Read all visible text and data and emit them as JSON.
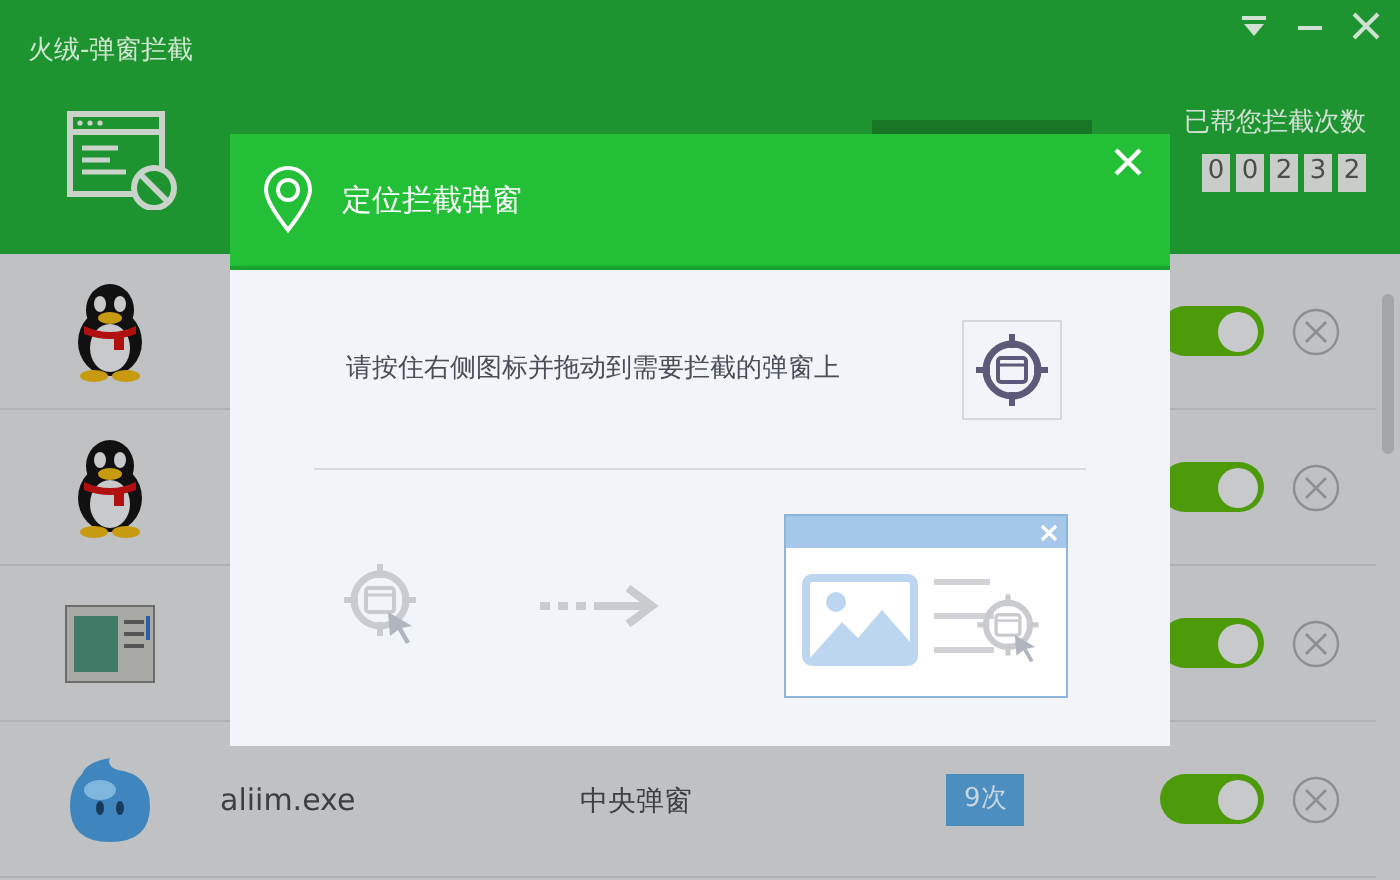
{
  "window": {
    "title": "火绒-弹窗拦截"
  },
  "counter": {
    "label": "已帮您拦截次数",
    "digits": [
      "0",
      "0",
      "2",
      "3",
      "2"
    ]
  },
  "apps": [
    {
      "kind": "penguin",
      "on": true
    },
    {
      "kind": "penguin",
      "on": true
    },
    {
      "kind": "window",
      "on": true
    },
    {
      "kind": "drop",
      "name": "aliim.exe",
      "type": "中央弹窗",
      "count": "9次",
      "on": true
    }
  ],
  "dialog": {
    "title": "定位拦截弹窗",
    "instruction": "请按住右侧图标并拖动到需要拦截的弹窗上"
  }
}
